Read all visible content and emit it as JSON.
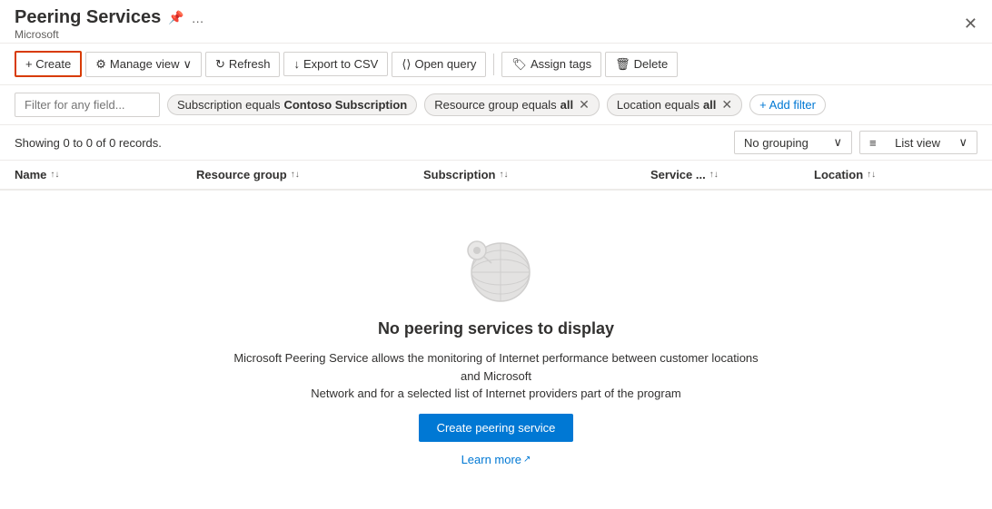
{
  "header": {
    "title": "Peering Services",
    "subtitle": "Microsoft",
    "pin_icon": "📌",
    "more_icon": "…"
  },
  "toolbar": {
    "create_label": "+ Create",
    "manage_view_label": "Manage view",
    "refresh_label": "Refresh",
    "export_label": "Export to CSV",
    "open_query_label": "Open query",
    "assign_tags_label": "Assign tags",
    "delete_label": "Delete"
  },
  "filters": {
    "placeholder": "Filter for any field...",
    "subscription_filter": "Subscription equals Contoso Subscription",
    "subscription_bold": "Contoso Subscription",
    "resource_group_filter": "Resource group equals all",
    "resource_group_bold": "all",
    "location_filter": "Location equals all",
    "location_bold": "all",
    "add_filter_label": "+ Add filter"
  },
  "records": {
    "text": "Showing 0 to 0 of 0 records.",
    "grouping_label": "No grouping",
    "view_label": "List view"
  },
  "table": {
    "columns": [
      "Name",
      "Resource group",
      "Subscription",
      "Service ...",
      "Location"
    ]
  },
  "empty_state": {
    "title": "No peering services to display",
    "description_part1": "Microsoft Peering Service allows the monitoring of Internet performance between customer locations and Microsoft",
    "description_part2": "Network and for a selected list of Internet providers part of the program",
    "create_button": "Create peering service",
    "learn_more": "Learn more"
  }
}
